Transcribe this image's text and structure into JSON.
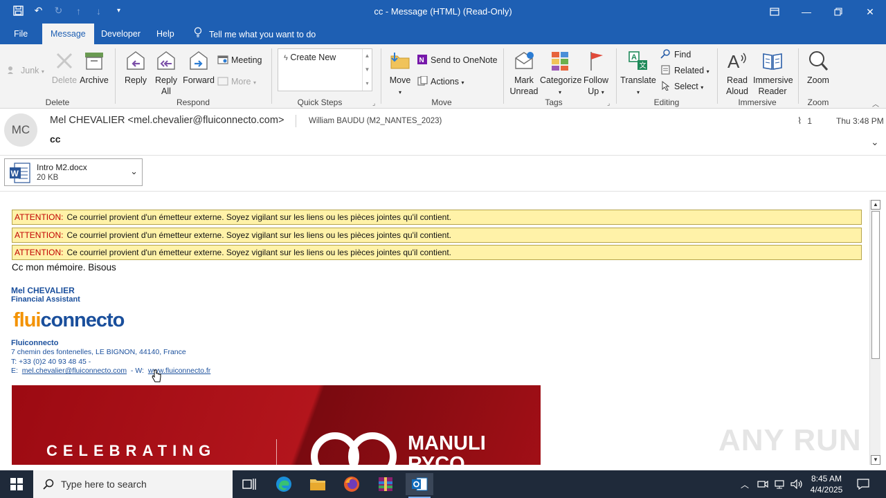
{
  "window": {
    "title": "cc  -  Message (HTML) (Read-Only)"
  },
  "tabs": [
    "File",
    "Message",
    "Developer",
    "Help"
  ],
  "tell_me": "Tell me what you want to do",
  "ribbon": {
    "junk": "Junk",
    "delete": "Delete",
    "archive": "Archive",
    "reply": "Reply",
    "reply_all_1": "Reply",
    "reply_all_2": "All",
    "forward": "Forward",
    "meeting": "Meeting",
    "more": "More",
    "quick_step_create": "Create New",
    "move": "Move",
    "send_onenote": "Send to OneNote",
    "actions": "Actions",
    "mark_unread_1": "Mark",
    "mark_unread_2": "Unread",
    "categorize": "Categorize",
    "follow_up_1": "Follow",
    "follow_up_2": "Up",
    "translate": "Translate",
    "find": "Find",
    "related": "Related",
    "select": "Select",
    "read_aloud_1": "Read",
    "read_aloud_2": "Aloud",
    "immersive_1": "Immersive",
    "immersive_2": "Reader",
    "zoom": "Zoom",
    "groups": {
      "delete": "Delete",
      "respond": "Respond",
      "quick_steps": "Quick Steps",
      "move": "Move",
      "tags": "Tags",
      "editing": "Editing",
      "immersive": "Immersive",
      "zoom": "Zoom"
    }
  },
  "message": {
    "avatar_initials": "MC",
    "from": "Mel CHEVALIER <mel.chevalier@fluiconnecto.com>",
    "to": "William BAUDU (M2_NANTES_2023)",
    "subject": "cc",
    "attachment_count": "1",
    "date": "Thu 3:48 PM",
    "attachment": {
      "name": "Intro M2.docx",
      "size": "20 KB"
    },
    "banners": [
      {
        "label": "ATTENTION:",
        "text": "Ce courriel provient d'un émetteur externe. Soyez vigilant sur les liens ou les pièces jointes qu'il contient."
      },
      {
        "label": "ATTENTION:",
        "text": "Ce courriel provient d'un émetteur externe. Soyez vigilant sur les liens ou les pièces jointes qu'il contient."
      },
      {
        "label": "ATTENTION:",
        "text": "Ce courriel provient d'un émetteur externe. Soyez vigilant sur les liens ou les pièces jointes qu'il contient."
      }
    ],
    "body": "Cc mon mémoire. Bisous",
    "signature": {
      "name": "Mel CHEVALIER",
      "title": "Financial Assistant",
      "logo_a": "flui",
      "logo_b": "connecto",
      "company": "Fluiconnecto",
      "address": "7 chemin des fontenelles, LE BIGNON, 44140, France",
      "tel": "T:  +33 (0)2 40 93 48 45  -",
      "email_prefix": "E:",
      "email": "mel.chevalier@fluiconnecto.com",
      "web_prefix": "- W:",
      "web": "www.fluiconnecto.fr"
    },
    "image_banner": {
      "celebrating": "CELEBRATING",
      "brand_line1": "MANULI",
      "brand_line2": "RYCO"
    }
  },
  "watermark": "ANY RUN",
  "taskbar": {
    "search_placeholder": "Type here to search",
    "time": "8:45 AM",
    "date": "4/4/2025"
  },
  "colors": {
    "accent": "#1e5fb3",
    "banner_bg": "#fff2a8",
    "attention": "#c00000",
    "sig_blue": "#1a4f9c",
    "logo_orange": "#f39200"
  }
}
